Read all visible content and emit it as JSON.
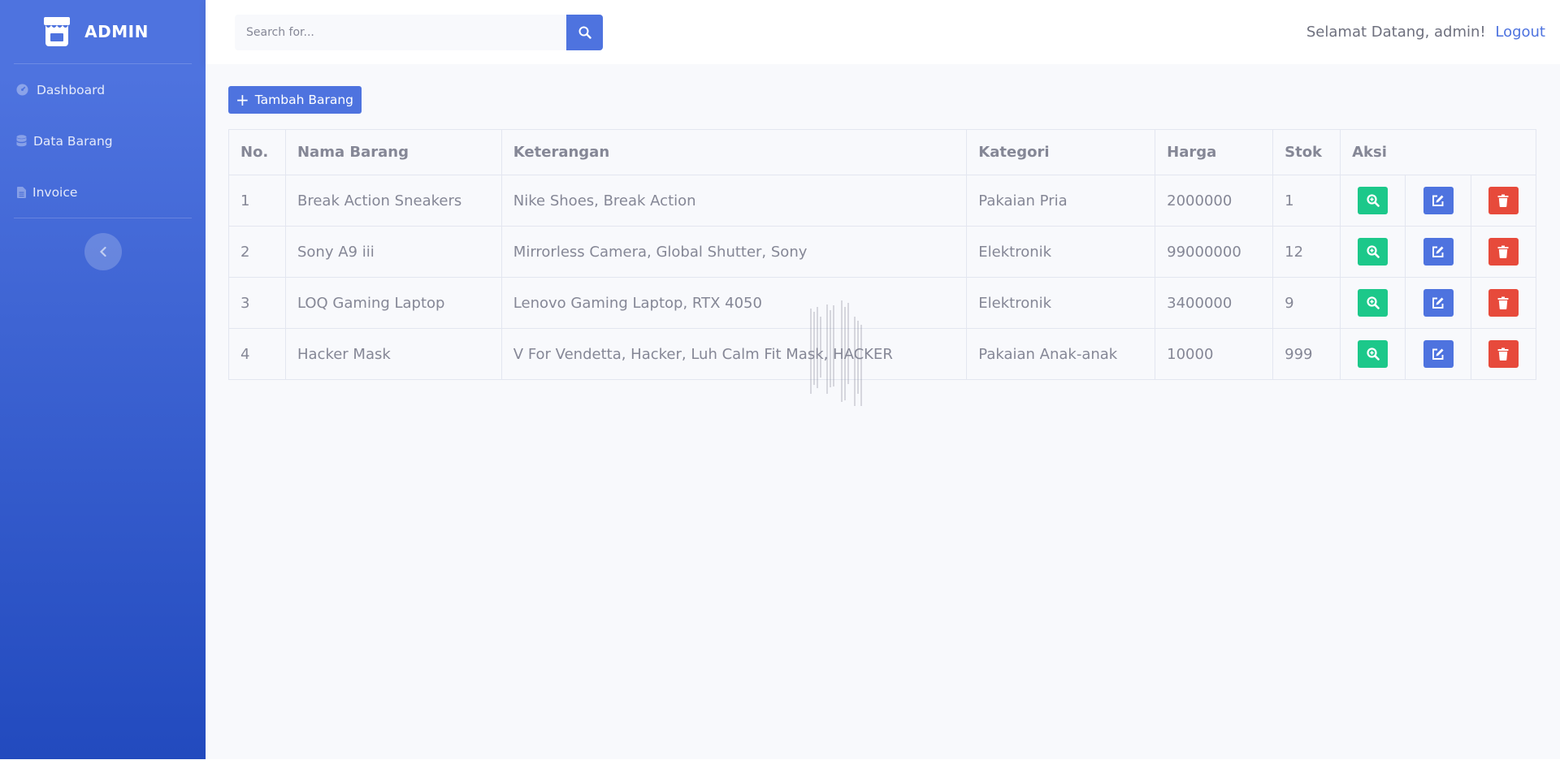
{
  "brand": {
    "name": "ADMIN"
  },
  "sidebar": {
    "items": [
      {
        "label": "Dashboard",
        "icon": "dashboard-icon"
      },
      {
        "label": "Data Barang",
        "icon": "database-icon"
      },
      {
        "label": "Invoice",
        "icon": "file-icon"
      }
    ],
    "toggle_icon": "chevron-left-icon"
  },
  "topbar": {
    "search_placeholder": "Search for...",
    "welcome": "Selamat Datang, admin!",
    "logout": "Logout"
  },
  "main": {
    "add_button": "Tambah Barang",
    "table": {
      "headers": [
        "No.",
        "Nama Barang",
        "Keterangan",
        "Kategori",
        "Harga",
        "Stok",
        "Aksi"
      ],
      "rows": [
        {
          "no": "1",
          "nama": "Break Action Sneakers",
          "keterangan": "Nike Shoes, Break Action",
          "kategori": "Pakaian Pria",
          "harga": "2000000",
          "stok": "1"
        },
        {
          "no": "2",
          "nama": "Sony A9 iii",
          "keterangan": "Mirrorless Camera, Global Shutter, Sony",
          "kategori": "Elektronik",
          "harga": "99000000",
          "stok": "12"
        },
        {
          "no": "3",
          "nama": "LOQ Gaming Laptop",
          "keterangan": "Lenovo Gaming Laptop, RTX 4050",
          "kategori": "Elektronik",
          "harga": "3400000",
          "stok": "9"
        },
        {
          "no": "4",
          "nama": "Hacker Mask",
          "keterangan": "V For Vendetta, Hacker, Luh Calm Fit Mask, HACKER",
          "kategori": "Pakaian Anak-anak",
          "harga": "10000",
          "stok": "999"
        }
      ]
    }
  },
  "colors": {
    "primary": "#4e73df",
    "success": "#1cc88a",
    "danger": "#e74a3b",
    "text": "#858796"
  }
}
